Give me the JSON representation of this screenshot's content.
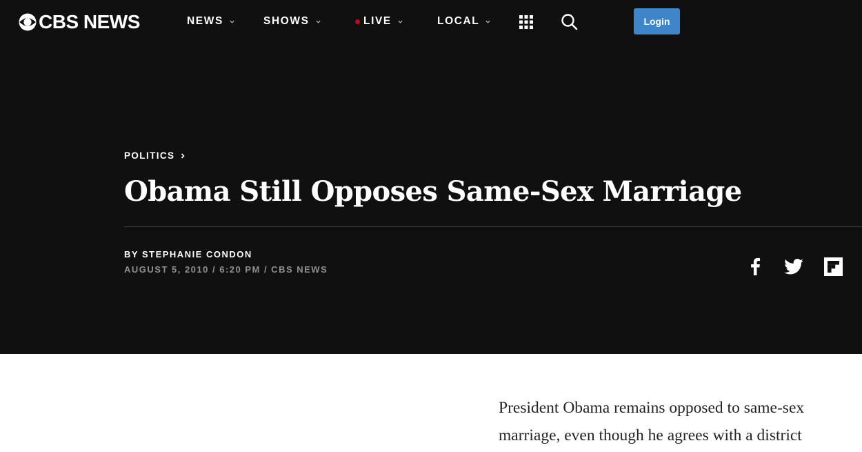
{
  "brand": {
    "logo_text": "CBS NEWS",
    "accent": "#3e86c9",
    "live_color": "#d0021b"
  },
  "nav": {
    "items": [
      {
        "label": "NEWS"
      },
      {
        "label": "SHOWS"
      },
      {
        "label": "LIVE"
      },
      {
        "label": "LOCAL"
      }
    ],
    "grid_icon": "apps-grid-icon",
    "search_icon": "search-icon",
    "login_label": "Login"
  },
  "article": {
    "section": "POLITICS",
    "headline": "Obama Still Opposes Same-Sex Marriage",
    "byline_prefix": "BY",
    "author": "STEPHANIE CONDON",
    "dateline": "AUGUST 5, 2010 / 6:20 PM / CBS NEWS",
    "share_icons": [
      "facebook-icon",
      "twitter-icon",
      "flipboard-icon"
    ],
    "body_lines": [
      "President Obama remains opposed to same-sex",
      "marriage, even though he agrees with a district"
    ]
  }
}
